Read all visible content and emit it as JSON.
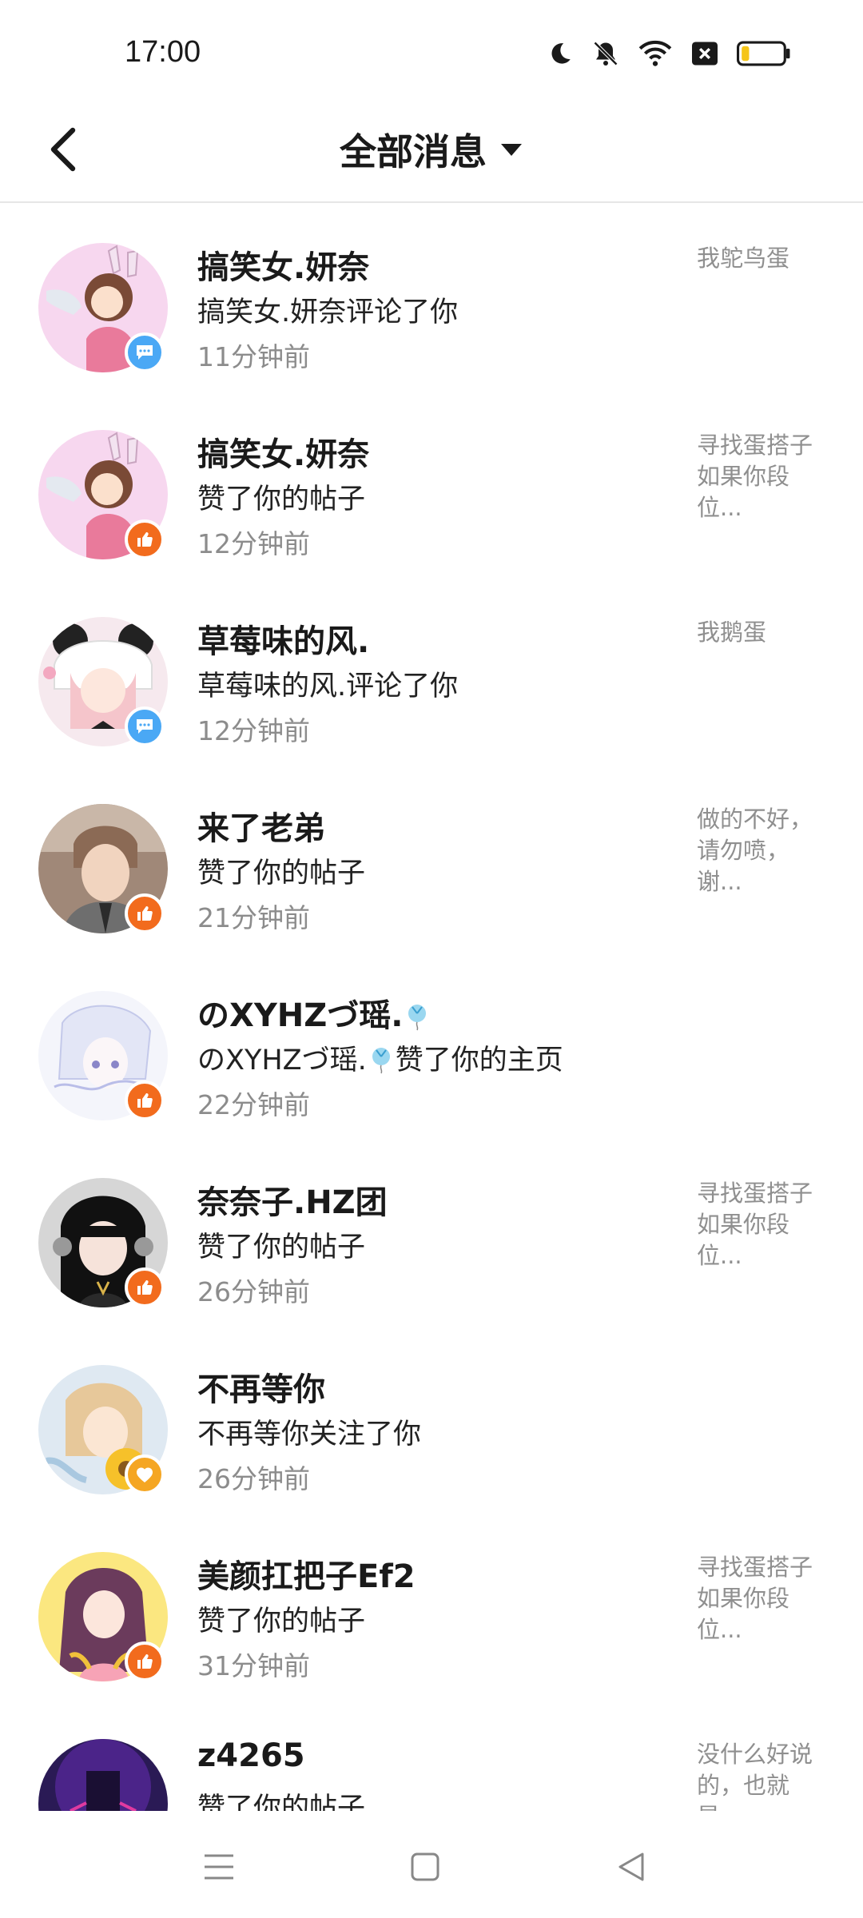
{
  "status_bar": {
    "time": "17:00",
    "icons": [
      "moon-icon",
      "bell-muted-icon",
      "wifi-icon",
      "sim-x-icon",
      "battery-icon"
    ],
    "battery_level": 0.15
  },
  "header": {
    "back_icon": "chevron-left-icon",
    "title": "全部消息",
    "dropdown_icon": "caret-down-icon"
  },
  "messages": [
    {
      "name": "搞笑女.妍奈",
      "action": "搞笑女.妍奈评论了你",
      "time": "11分钟前",
      "preview": "我鸵鸟蛋",
      "badge": "comment"
    },
    {
      "name": "搞笑女.妍奈",
      "action": "赞了你的帖子",
      "time": "12分钟前",
      "preview": "寻找蛋搭子\n如果你段\n位...",
      "badge": "like"
    },
    {
      "name": "草莓味的风.",
      "action": "草莓味的风.评论了你",
      "time": "12分钟前",
      "preview": "我鹅蛋",
      "badge": "comment"
    },
    {
      "name": "来了老弟",
      "action": "赞了你的帖子",
      "time": "21分钟前",
      "preview": "做的不好，\n请勿喷，\n谢...",
      "badge": "like"
    },
    {
      "name": "のXYHZづ瑶.",
      "action": "のXYHZづ瑶.",
      "action_suffix": "赞了你的主页",
      "time": "22分钟前",
      "preview": "",
      "badge": "like"
    },
    {
      "name": "奈奈子.HZ团",
      "action": "赞了你的帖子",
      "time": "26分钟前",
      "preview": "寻找蛋搭子\n如果你段\n位...",
      "badge": "like"
    },
    {
      "name": "不再等你",
      "action": "不再等你关注了你",
      "time": "26分钟前",
      "preview": "",
      "badge": "follow"
    },
    {
      "name": "美颜扛把子Ef2",
      "action": "赞了你的帖子",
      "time": "31分钟前",
      "preview": "寻找蛋搭子\n如果你段\n位...",
      "badge": "like"
    },
    {
      "name": "z4265",
      "action": "赞了你的帖子",
      "time": "",
      "preview": "没什么好说\n的，也就\n是...",
      "badge": "like"
    }
  ],
  "nav_bar": {
    "icons": [
      "menu-icon",
      "home-square-icon",
      "back-triangle-icon"
    ]
  },
  "colors": {
    "comment_badge": "#4aa8f5",
    "like_badge": "#f26b1d",
    "follow_badge": "#f5a623"
  }
}
